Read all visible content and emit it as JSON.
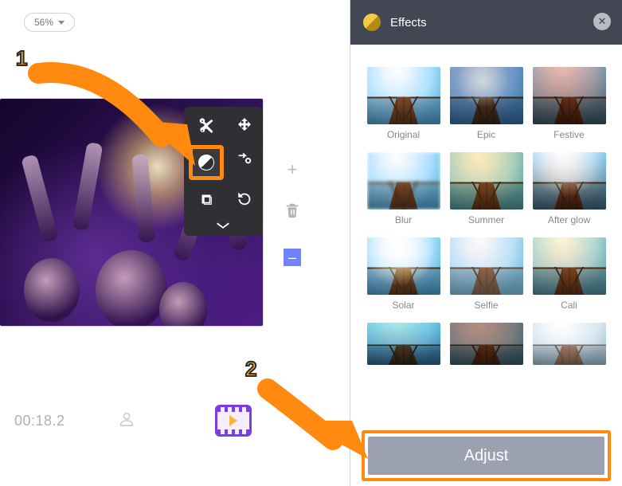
{
  "zoom": {
    "value": "56%"
  },
  "timeline": {
    "timestamp": "00:18.2"
  },
  "clip_tools": {
    "cut": "cut",
    "move": "move",
    "color": "color-adjust",
    "transition": "transition",
    "crop": "crop",
    "rotate": "rotate"
  },
  "panel": {
    "title": "Effects",
    "adjust_label": "Adjust",
    "effects": [
      {
        "label": "Original",
        "variant": "v-original"
      },
      {
        "label": "Epic",
        "variant": "v-epic"
      },
      {
        "label": "Festive",
        "variant": "v-festive"
      },
      {
        "label": "Blur",
        "variant": "v-blur"
      },
      {
        "label": "Summer",
        "variant": "v-summer"
      },
      {
        "label": "After glow",
        "variant": "v-afterglow"
      },
      {
        "label": "Solar",
        "variant": "v-solar"
      },
      {
        "label": "Selfie",
        "variant": "v-selfie"
      },
      {
        "label": "Cali",
        "variant": "v-cali"
      },
      {
        "label": "",
        "variant": "v-extra1"
      },
      {
        "label": "",
        "variant": "v-extra2"
      },
      {
        "label": "",
        "variant": "v-extra3"
      }
    ]
  },
  "annotations": {
    "step1": "1",
    "step2": "2"
  }
}
